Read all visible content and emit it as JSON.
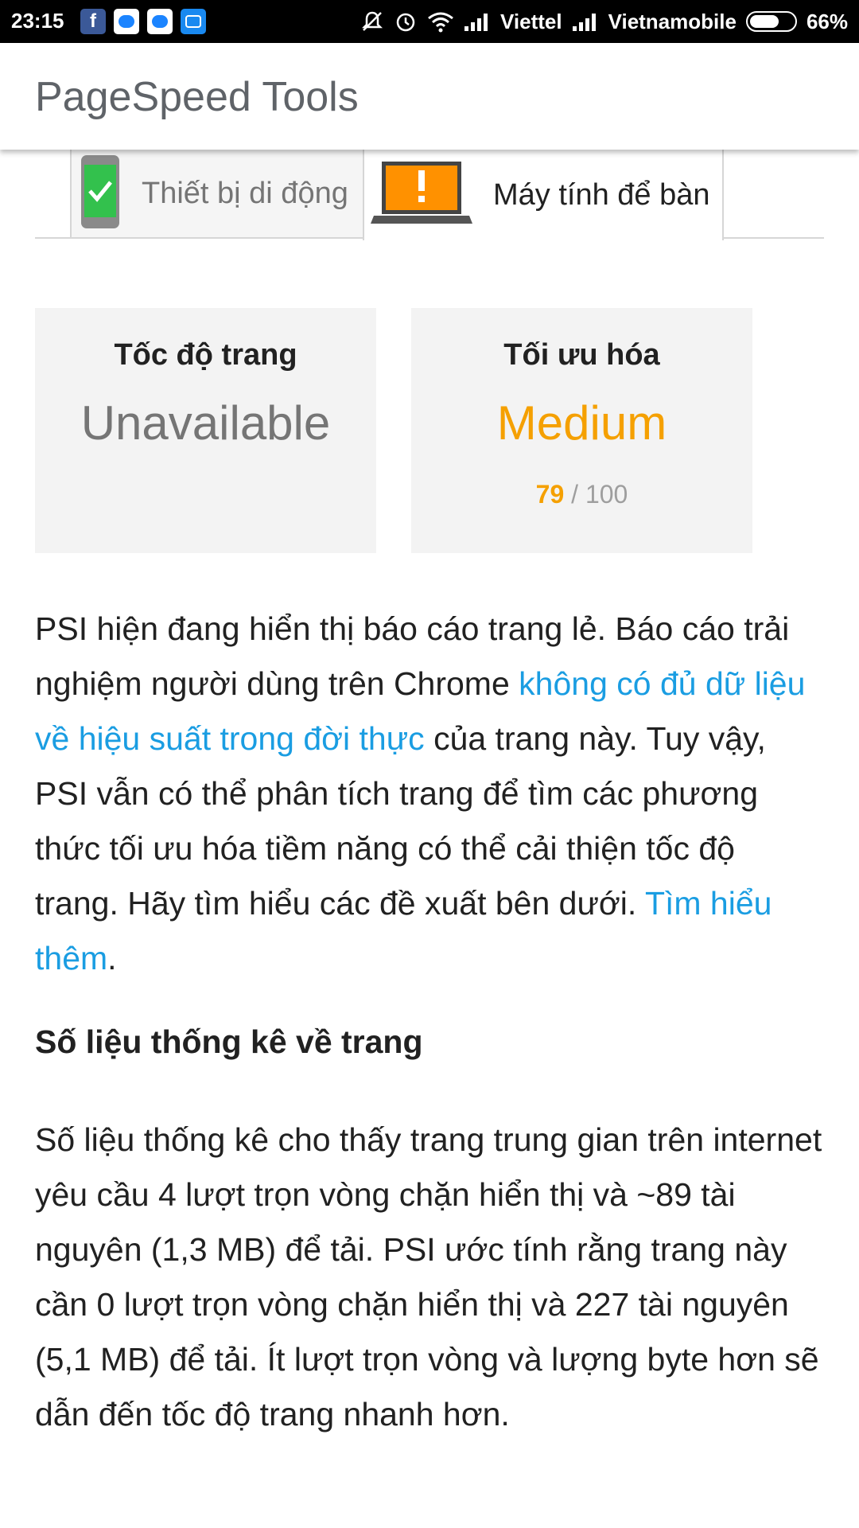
{
  "status_bar": {
    "time": "23:15",
    "notification_icons": [
      "facebook-icon",
      "messenger-icon",
      "messenger-icon",
      "zalo-icon"
    ],
    "carrier_1": "Viettel",
    "carrier_2": "Vietnamobile",
    "battery_percent": "66%",
    "battery_level": 0.66
  },
  "app_bar": {
    "title": "PageSpeed Tools"
  },
  "tabs": [
    {
      "label": "Thiết bị di động",
      "icon": "mobile-ok-icon",
      "selected": false
    },
    {
      "label": "Máy tính để bàn",
      "icon": "desktop-warning-icon",
      "selected": true
    }
  ],
  "cards": {
    "speed": {
      "title": "Tốc độ trang",
      "value": "Unavailable"
    },
    "optimization": {
      "title": "Tối ưu hóa",
      "value": "Medium",
      "score": "79",
      "score_separator": "/",
      "score_max": "100"
    }
  },
  "colors": {
    "accent_orange": "#f5a000",
    "link_blue": "#1a9de2",
    "ok_green": "#33c14d"
  },
  "intro": {
    "text_1": "PSI hiện đang hiển thị báo cáo trang lẻ. Báo cáo trải nghiệm người dùng trên Chrome ",
    "link_1": "không có đủ dữ liệu về hiệu suất trong đời thực",
    "text_2": " của trang này. Tuy vậy, PSI vẫn có thể phân tích trang để tìm các phương thức tối ưu hóa tiềm năng có thể cải thiện tốc độ trang. Hãy tìm hiểu các đề xuất bên dưới. ",
    "link_2": "Tìm hiểu thêm",
    "text_3": "."
  },
  "stats": {
    "heading": "Số liệu thống kê về trang",
    "body": "Số liệu thống kê cho thấy trang trung gian trên internet yêu cầu 4 lượt trọn vòng chặn hiển thị và ~89 tài nguyên (1,3 MB) để tải. PSI ước tính rằng trang này cần 0 lượt trọn vòng chặn hiển thị và 227 tài nguyên (5,1 MB) để tải. Ít lượt trọn vòng và lượng byte hơn sẽ dẫn đến tốc độ trang nhanh hơn."
  }
}
